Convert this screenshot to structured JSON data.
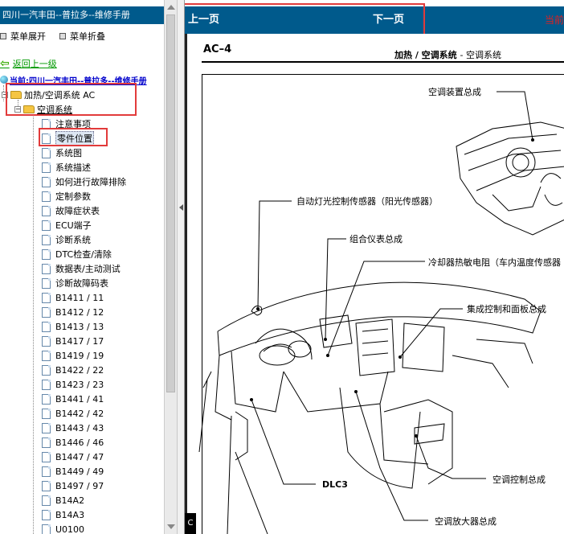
{
  "left_panel": {
    "title": "四川一汽丰田--普拉多--维修手册",
    "expand_label": "菜单展开",
    "collapse_label": "菜单折叠",
    "back_label": "返回上一级",
    "current_label": "当前:四川一汽丰田--普拉多--维修手册",
    "category": "加热/空调系统 AC",
    "subcategory": "空调系统",
    "items": [
      "注意事项",
      "零件位置",
      "系统图",
      "系统描述",
      "如何进行故障排除",
      "定制参数",
      "故障症状表",
      "ECU端子",
      "诊断系统",
      "DTC检查/清除",
      "数据表/主动测试",
      "诊断故障码表",
      "B1411 / 11",
      "B1412 / 12",
      "B1413 / 13",
      "B1417 / 17",
      "B1419 / 19",
      "B1422 / 22",
      "B1423 / 23",
      "B1441 / 41",
      "B1442 / 42",
      "B1443 / 43",
      "B1446 / 46",
      "B1447 / 47",
      "B1449 / 49",
      "B1497 / 97",
      "B14A2",
      "B14A3",
      "U0100"
    ],
    "selected_index": 1
  },
  "content": {
    "prev_label": "上一页",
    "next_label": "下一页",
    "current_link": "当前",
    "page_code": "AC–4",
    "page_header": "加热 / 空调系统",
    "page_subheader": "-  空调系统",
    "left_mark": "C",
    "callouts": {
      "c1": "空调装置总成",
      "c2": "自动灯光控制传感器（阳光传感器）",
      "c3": "组合仪表总成",
      "c4": "冷却器热敏电阻（车内温度传感器",
      "c5": "集成控制和面板总成",
      "c6": "DLC3",
      "c7": "空调控制总成",
      "c8": "空调放大器总成"
    }
  },
  "colors": {
    "header_blue": "#005a8c",
    "highlight_red": "#e23b3b",
    "back_green": "#009900",
    "current_blue": "#0000cc"
  }
}
